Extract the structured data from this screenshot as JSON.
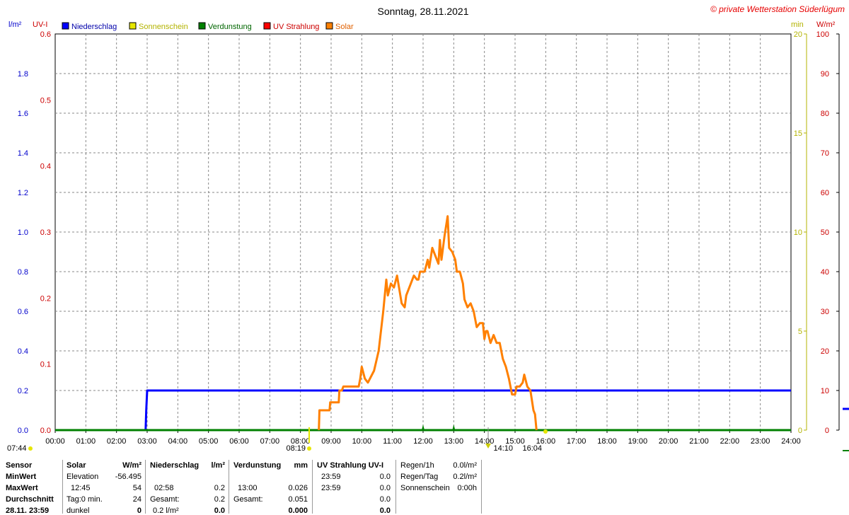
{
  "title": "Sonntag, 28.11.2021",
  "copyright": "© private Wetterstation Süderlügum",
  "axes": {
    "left1": {
      "unit": "l/m²",
      "ticks": [
        "0.0",
        "0.2",
        "0.4",
        "0.6",
        "0.8",
        "1.0",
        "1.2",
        "1.4",
        "1.6",
        "1.8"
      ],
      "color": "#0000cc"
    },
    "left2": {
      "unit": "UV-I",
      "ticks": [
        "0.0",
        "0.1",
        "0.2",
        "0.3",
        "0.4",
        "0.5",
        "0.6"
      ],
      "color": "#cc0000"
    },
    "right1": {
      "unit": "min",
      "ticks": [
        "0",
        "5",
        "10",
        "15",
        "20"
      ],
      "color": "#b3b300"
    },
    "right2": {
      "unit": "W/m²",
      "ticks": [
        "0",
        "10",
        "20",
        "30",
        "40",
        "50",
        "60",
        "70",
        "80",
        "90",
        "100"
      ],
      "color": "#cc0000"
    },
    "x_ticks": [
      "00:00",
      "01:00",
      "02:00",
      "03:00",
      "04:00",
      "05:00",
      "06:00",
      "07:00",
      "08:00",
      "09:00",
      "10:00",
      "11:00",
      "12:00",
      "13:00",
      "14:00",
      "15:00",
      "16:00",
      "17:00",
      "18:00",
      "19:00",
      "20:00",
      "21:00",
      "22:00",
      "23:00",
      "24:00"
    ]
  },
  "legend": [
    {
      "label": "Niederschlag",
      "color": "#0000ff",
      "text_color": "#0000aa"
    },
    {
      "label": "Sonnenschein",
      "color": "#e6e600",
      "text_color": "#b3b300"
    },
    {
      "label": "Verdunstung",
      "color": "#008000",
      "text_color": "#006600"
    },
    {
      "label": "UV Strahlung",
      "color": "#ff0000",
      "text_color": "#cc0000"
    },
    {
      "label": "Solar",
      "color": "#ff8000",
      "text_color": "#e06000"
    }
  ],
  "time_markers": {
    "sunrise_label": "07:44",
    "dawn_label": "08:19",
    "transit_label": "14:10",
    "sunset_label": "16:04"
  },
  "chart_data": {
    "type": "line",
    "x_unit": "hours",
    "series": [
      {
        "name": "Niederschlag",
        "unit": "l/m²",
        "color": "#0000ff",
        "points": [
          [
            0,
            0
          ],
          [
            2.95,
            0
          ],
          [
            2.97,
            0.1
          ],
          [
            3.0,
            0.2
          ],
          [
            24,
            0.2
          ]
        ]
      },
      {
        "name": "Verdunstung",
        "unit": "mm",
        "color": "#008000",
        "points": [
          [
            0,
            0
          ],
          [
            24,
            0
          ]
        ]
      },
      {
        "name": "Solar",
        "unit": "W/m²",
        "color": "#ff8000",
        "points": [
          [
            8.6,
            0
          ],
          [
            8.62,
            5
          ],
          [
            8.95,
            5
          ],
          [
            8.97,
            7
          ],
          [
            9.25,
            7
          ],
          [
            9.27,
            10
          ],
          [
            9.35,
            10
          ],
          [
            9.4,
            11
          ],
          [
            9.7,
            11
          ],
          [
            9.9,
            11
          ],
          [
            9.95,
            13
          ],
          [
            10.0,
            16
          ],
          [
            10.1,
            13
          ],
          [
            10.2,
            12
          ],
          [
            10.4,
            15
          ],
          [
            10.55,
            20
          ],
          [
            10.7,
            30
          ],
          [
            10.8,
            38
          ],
          [
            10.85,
            34
          ],
          [
            10.95,
            37
          ],
          [
            11.05,
            36
          ],
          [
            11.15,
            39
          ],
          [
            11.3,
            32
          ],
          [
            11.4,
            31
          ],
          [
            11.45,
            34
          ],
          [
            11.55,
            36
          ],
          [
            11.7,
            39
          ],
          [
            11.8,
            38
          ],
          [
            11.85,
            38
          ],
          [
            11.9,
            40
          ],
          [
            12.05,
            40
          ],
          [
            12.15,
            43
          ],
          [
            12.2,
            41
          ],
          [
            12.3,
            46
          ],
          [
            12.4,
            44
          ],
          [
            12.5,
            42
          ],
          [
            12.55,
            48
          ],
          [
            12.6,
            43
          ],
          [
            12.7,
            49
          ],
          [
            12.8,
            54
          ],
          [
            12.85,
            46
          ],
          [
            12.95,
            45
          ],
          [
            13.05,
            43
          ],
          [
            13.1,
            40
          ],
          [
            13.2,
            40
          ],
          [
            13.3,
            37
          ],
          [
            13.35,
            33
          ],
          [
            13.45,
            31
          ],
          [
            13.55,
            32
          ],
          [
            13.65,
            30
          ],
          [
            13.75,
            26
          ],
          [
            13.85,
            27
          ],
          [
            13.95,
            27
          ],
          [
            14.0,
            23
          ],
          [
            14.05,
            25
          ],
          [
            14.1,
            25
          ],
          [
            14.2,
            22
          ],
          [
            14.3,
            24
          ],
          [
            14.4,
            22
          ],
          [
            14.5,
            22
          ],
          [
            14.6,
            18
          ],
          [
            14.7,
            16
          ],
          [
            14.8,
            13
          ],
          [
            14.9,
            9
          ],
          [
            15.0,
            9
          ],
          [
            15.05,
            11
          ],
          [
            15.15,
            11
          ],
          [
            15.25,
            12
          ],
          [
            15.3,
            14
          ],
          [
            15.4,
            11
          ],
          [
            15.5,
            10
          ],
          [
            15.6,
            5
          ],
          [
            15.65,
            4
          ],
          [
            15.7,
            0
          ]
        ]
      }
    ]
  },
  "panel": {
    "rows_labels": [
      "Sensor",
      "MinWert",
      "MaxWert",
      "Durchschnitt",
      "28.11. 23:59"
    ],
    "solar": {
      "header": "Solar",
      "unit": "W/m²",
      "r1a": "Elevation",
      "r1b": "-56.495",
      "r2a": "12:45",
      "r2b": "54",
      "r3a": "Tag:0 min.",
      "r3b": "24",
      "r4a": "dunkel",
      "r4b": "0"
    },
    "rain": {
      "header": "Niederschlag",
      "unit": "l/m²",
      "r1a": "",
      "r1b": "",
      "r2a": "02:58",
      "r2b": "0.2",
      "r3a": "Gesamt:",
      "r3b": "0.2",
      "r4a": "0.2 l/m²",
      "r4b": "0.0"
    },
    "evap": {
      "header": "Verdunstung",
      "unit": "mm",
      "r1a": "",
      "r1b": "",
      "r2a": "13:00",
      "r2b": "0.026",
      "r3a": "Gesamt:",
      "r3b": "0.051",
      "r4a": "",
      "r4b": "0.000"
    },
    "uv": {
      "header": "UV Strahlung UV-I",
      "r1a": "23:59",
      "r1b": "0.0",
      "r2a": "23:59",
      "r2b": "0.0",
      "r3a": "",
      "r3b": "0.0",
      "r4a": "",
      "r4b": "0.0"
    },
    "extra": {
      "l1": "Regen/1h",
      "v1": "0.0l/m²",
      "l2": "Regen/Tag",
      "v2": "0.2l/m²",
      "l3": "Sonnenschein",
      "v3": "0:00h"
    }
  }
}
